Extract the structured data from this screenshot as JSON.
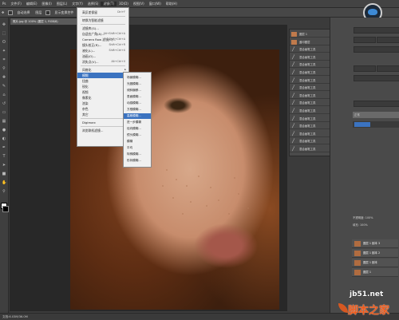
{
  "menubar": {
    "items": [
      "Ps",
      "文件(F)",
      "编辑(E)",
      "图像(I)",
      "图层(L)",
      "文字(Y)",
      "选择(S)",
      "滤镜(T)",
      "3D(D)",
      "视图(V)",
      "窗口(W)",
      "帮助(H)"
    ],
    "active_index": 7
  },
  "options": {
    "items": [
      "自动选择",
      "图层",
      "显示变换控件"
    ]
  },
  "document_tab": "照片.jpg @ 100% (图层 1, RGB/8)",
  "filter_menu": {
    "items": [
      {
        "label": "高反差保留",
        "shortcut": "Ctrl+F",
        "arrow": false
      },
      {
        "label": "转换为智能滤镜",
        "shortcut": "",
        "arrow": false
      },
      {
        "label": "滤镜库(G)...",
        "shortcut": "",
        "arrow": false
      },
      {
        "label": "自适应广角(A)...",
        "shortcut": "Alt+Shift+Ctrl+A",
        "arrow": false
      },
      {
        "label": "Camera Raw 滤镜(C)...",
        "shortcut": "Shift+Ctrl+A",
        "arrow": false
      },
      {
        "label": "镜头校正(R)...",
        "shortcut": "Shift+Ctrl+R",
        "arrow": false
      },
      {
        "label": "液化(L)...",
        "shortcut": "Shift+Ctrl+X",
        "arrow": false
      },
      {
        "label": "油画(O)...",
        "shortcut": "",
        "arrow": false
      },
      {
        "label": "消失点(V)...",
        "shortcut": "Alt+Ctrl+V",
        "arrow": false
      },
      {
        "label": "风格化",
        "shortcut": "",
        "arrow": true
      },
      {
        "label": "模糊",
        "shortcut": "",
        "arrow": true
      },
      {
        "label": "扭曲",
        "shortcut": "",
        "arrow": true
      },
      {
        "label": "锐化",
        "shortcut": "",
        "arrow": true
      },
      {
        "label": "视频",
        "shortcut": "",
        "arrow": true
      },
      {
        "label": "像素化",
        "shortcut": "",
        "arrow": true
      },
      {
        "label": "渲染",
        "shortcut": "",
        "arrow": true
      },
      {
        "label": "杂色",
        "shortcut": "",
        "arrow": true
      },
      {
        "label": "其它",
        "shortcut": "",
        "arrow": true
      },
      {
        "label": "Digimarc",
        "shortcut": "",
        "arrow": true
      },
      {
        "label": "浏览联机滤镜...",
        "shortcut": "",
        "arrow": false
      }
    ],
    "highlight_index": 10
  },
  "blur_submenu": {
    "items": [
      "场景模糊...",
      "光圈模糊...",
      "倾斜偏移...",
      "表面模糊...",
      "动感模糊...",
      "方框模糊...",
      "高斯模糊...",
      "进一步模糊",
      "径向模糊...",
      "镜头模糊...",
      "模糊",
      "平均",
      "特殊模糊...",
      "形状模糊..."
    ],
    "highlight_index": 6
  },
  "history_panel": {
    "items": [
      "图层 1",
      "盖印图层",
      "混合画笔工具",
      "混合画笔工具",
      "混合画笔工具",
      "混合画笔工具",
      "混合画笔工具",
      "混合画笔工具",
      "混合画笔工具",
      "混合画笔工具",
      "混合画笔工具",
      "混合画笔工具",
      "混合画笔工具",
      "混合画笔工具",
      "混合画笔工具",
      "混合画笔工具"
    ]
  },
  "right_panel": {
    "mode_label": "正常",
    "opacity_label": "不透明度: 100%",
    "fill_label": "填充: 100%"
  },
  "layers_panel": {
    "items": [
      "图层 1 副本 3",
      "图层 1 副本 2",
      "图层 1 副本",
      "图层 1"
    ]
  },
  "statusbar": "文档:6.03M/36.0M",
  "watermark": {
    "url": "jb51.net",
    "name": "脚本之家"
  }
}
